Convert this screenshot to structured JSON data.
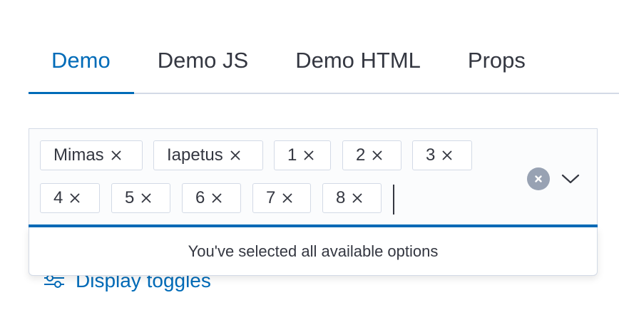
{
  "tabs": [
    {
      "label": "Demo",
      "selected": true
    },
    {
      "label": "Demo JS",
      "selected": false
    },
    {
      "label": "Demo HTML",
      "selected": false
    },
    {
      "label": "Props",
      "selected": false
    }
  ],
  "combo": {
    "selected_options": [
      "Mimas",
      "Iapetus",
      "1",
      "2",
      "3",
      "4",
      "5",
      "6",
      "7",
      "8"
    ],
    "clear_icon": "clear-circle-icon",
    "toggle_icon": "chevron-down-icon"
  },
  "popover": {
    "message": "You've selected all available options"
  },
  "display_toggles": {
    "label": "Display toggles",
    "icon": "controls-icon"
  },
  "colors": {
    "accent": "#006bb8",
    "text": "#343741",
    "border": "#d3dae6",
    "clear_button": "#98a2b3"
  }
}
